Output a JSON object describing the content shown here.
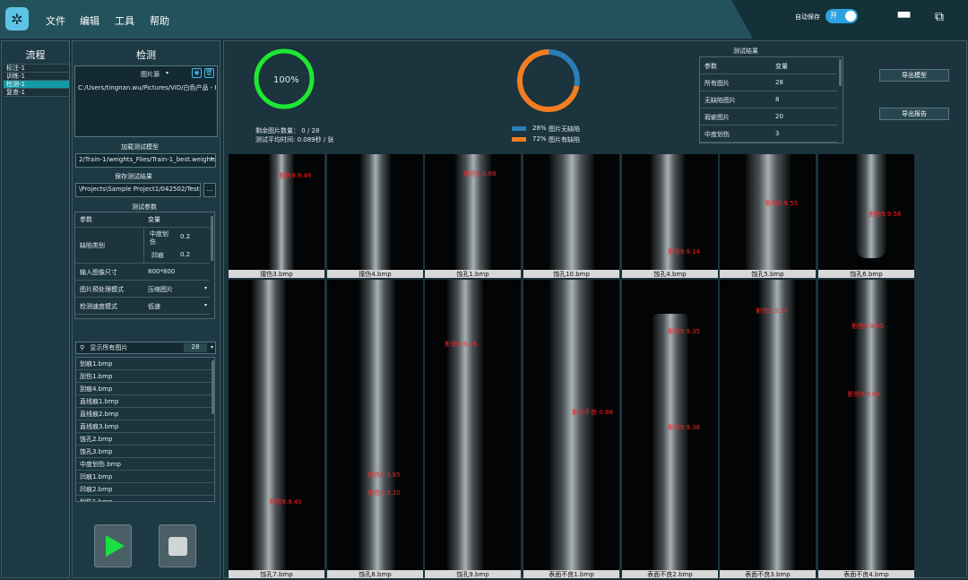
{
  "menu": [
    "文件",
    "编辑",
    "工具",
    "帮助"
  ],
  "autosave": {
    "label": "自动保存",
    "toggle": "开"
  },
  "flow": {
    "title": "流程",
    "items": [
      "标注-1",
      "训练-1",
      "检测-1",
      "复查-1"
    ],
    "active": 2
  },
  "detect": {
    "title": "检测",
    "source": "图片源",
    "path": "C:/Users/tingnan.wu/Pictures/ViD/白色产品 - P",
    "load_model": "加载测试模型",
    "model_path": "2/Train-1/weights_Files/Train-1_best.weights",
    "save_result": "保存测试结果",
    "result_path": "\\Projects\\Sample Project1/042502/Test-1",
    "browse": "...",
    "params_title": "测试参数",
    "params_head": [
      "参数",
      "变量"
    ],
    "defect_label": "缺陷类别",
    "defects": [
      {
        "name": "中度划伤",
        "value": "0.2"
      },
      {
        "name": "凹痕",
        "value": "0.2"
      }
    ],
    "input_size": {
      "label": "输入图像尺寸",
      "value": "800*800"
    },
    "preprocess": {
      "label": "图片预处理模式",
      "value": "压缩图片"
    },
    "speed": {
      "label": "检测速度模式",
      "value": "低速"
    },
    "filter": "显示所有图片",
    "count": "28",
    "files": [
      "划痕1.bmp",
      "刮伤1.bmp",
      "刮痕4.bmp",
      "直线痕1.bmp",
      "直线痕2.bmp",
      "直线痕3.bmp",
      "蚀孔2.bmp",
      "蚀孔3.bmp",
      "中度划伤.bmp",
      "凹痕1.bmp",
      "凹痕2.bmp",
      "划伤1.bmp"
    ]
  },
  "stats": {
    "percent": "100%",
    "remaining": "剩余图片数量： 0 / 28",
    "avg_time": "测试平均时间: 0.089秒 / 张"
  },
  "donut": {
    "items": [
      {
        "pct": "28%",
        "label": "图片无缺陷",
        "color": "#2a7fb8",
        "value": 28
      },
      {
        "pct": "72%",
        "label": "图片有缺陷",
        "color": "#f47d20",
        "value": 72
      }
    ]
  },
  "results": {
    "title": "测试结果",
    "head": [
      "参数",
      "变量"
    ],
    "rows": [
      [
        "所有图片",
        "28"
      ],
      [
        "无缺陷图片",
        "8"
      ],
      [
        "瑕疵图片",
        "20"
      ],
      [
        "中度划伤",
        "3"
      ]
    ]
  },
  "buttons": {
    "export_model": "导出模型",
    "export_report": "导出报告"
  },
  "images": [
    {
      "name": "撞伤3.bmp",
      "dets": [
        "影伤9.9.46"
      ]
    },
    {
      "name": "撞伤4.bmp",
      "dets": []
    },
    {
      "name": "蚀孔1.bmp",
      "dets": [
        "影伤9.9.88"
      ]
    },
    {
      "name": "蚀孔10.bmp",
      "dets": []
    },
    {
      "name": "蚀孔4.bmp",
      "dets": [
        "影伤9.9.14"
      ]
    },
    {
      "name": "蚀孔5.bmp",
      "dets": [
        "影伤9.9.55"
      ]
    },
    {
      "name": "蚀孔6.bmp",
      "dets": [
        "影伤9.9.56"
      ]
    },
    {
      "name": "蚀孔7.bmp",
      "dets": [
        "影伤9.9.40"
      ]
    },
    {
      "name": "蚀孔8.bmp",
      "dets": [
        "影伤9.9.85",
        "影伤9.9.20"
      ]
    },
    {
      "name": "蚀孔9.bmp",
      "dets": [
        "影伤9.9.26"
      ]
    },
    {
      "name": "表面不良1.bmp",
      "dets": [
        "影伤不良:0.88"
      ]
    },
    {
      "name": "表面不良2.bmp",
      "dets": [
        "影伤9.9.35",
        "影伤9.9.36"
      ]
    },
    {
      "name": "表面不良3.bmp",
      "dets": [
        "影伤9.9.26"
      ]
    },
    {
      "name": "表面不良4.bmp",
      "dets": [
        "影伤9.9.95",
        "影伤9.9.86"
      ]
    }
  ]
}
